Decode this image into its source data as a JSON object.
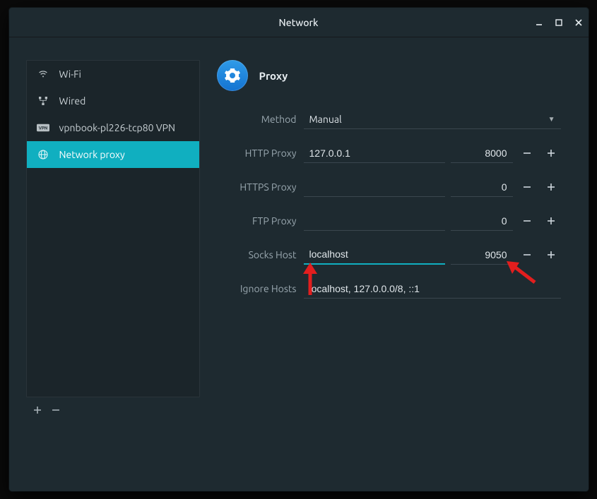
{
  "window": {
    "title": "Network"
  },
  "sidebar": {
    "items": [
      {
        "label": "Wi-Fi"
      },
      {
        "label": "Wired"
      },
      {
        "label": "vpnbook-pl226-tcp80 VPN"
      },
      {
        "label": "Network proxy"
      }
    ],
    "selected_index": 3
  },
  "main": {
    "title": "Proxy",
    "method": {
      "label": "Method",
      "value": "Manual"
    },
    "rows": {
      "http_proxy": {
        "label": "HTTP Proxy",
        "host": "127.0.0.1",
        "port": "8000"
      },
      "https_proxy": {
        "label": "HTTPS Proxy",
        "host": "",
        "port": "0"
      },
      "ftp_proxy": {
        "label": "FTP Proxy",
        "host": "",
        "port": "0"
      },
      "socks_host": {
        "label": "Socks Host",
        "host": "localhost",
        "port": "9050"
      }
    },
    "ignore_hosts": {
      "label": "Ignore Hosts",
      "value": "localhost, 127.0.0.0/8, ::1"
    }
  }
}
